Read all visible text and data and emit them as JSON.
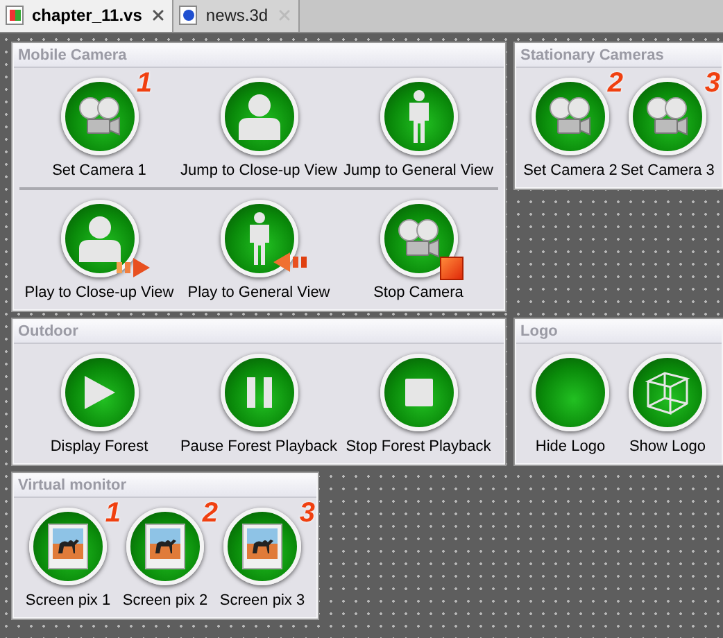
{
  "tabs": [
    {
      "label": "chapter_11.vs",
      "selected": true
    },
    {
      "label": "news.3d",
      "selected": false
    }
  ],
  "panel_rows": [
    {
      "panels": [
        {
          "title": "Mobile Camera",
          "kind": "wide",
          "rows": [
            [
              {
                "label": "Set Camera 1",
                "kind": "camera",
                "badge": "1"
              },
              {
                "label": "Jump to Close-up View",
                "kind": "closeup"
              },
              {
                "label": "Jump to General View",
                "kind": "general"
              }
            ],
            [
              {
                "label": "Play to Close-up View",
                "kind": "playcloseup"
              },
              {
                "label": "Play to General View",
                "kind": "playgeneral"
              },
              {
                "label": "Stop Camera",
                "kind": "stopcamera"
              }
            ]
          ]
        },
        {
          "title": "Stationary Cameras",
          "kind": "compact",
          "rows": [
            [
              {
                "label": "Set Camera 2",
                "kind": "camera",
                "badge": "2"
              },
              {
                "label": "Set Camera 3",
                "kind": "camera",
                "badge": "3"
              }
            ]
          ]
        }
      ]
    },
    {
      "panels": [
        {
          "title": "Outdoor",
          "kind": "wide",
          "rows": [
            [
              {
                "label": "Display Forest",
                "kind": "play"
              },
              {
                "label": "Pause Forest Playback",
                "kind": "pause"
              },
              {
                "label": "Stop Forest Playback",
                "kind": "stop"
              }
            ]
          ]
        },
        {
          "title": "Logo",
          "kind": "compact",
          "rows": [
            [
              {
                "label": "Hide Logo",
                "kind": "blank"
              },
              {
                "label": "Show Logo",
                "kind": "cube"
              }
            ]
          ]
        }
      ]
    },
    {
      "panels": [
        {
          "title": "Virtual monitor",
          "kind": "compact",
          "rows": [
            [
              {
                "label": "Screen pix 1",
                "kind": "photo",
                "badge": "1"
              },
              {
                "label": "Screen pix 2",
                "kind": "photo",
                "badge": "2"
              },
              {
                "label": "Screen pix 3",
                "kind": "photo",
                "badge": "3"
              }
            ]
          ]
        }
      ]
    }
  ]
}
